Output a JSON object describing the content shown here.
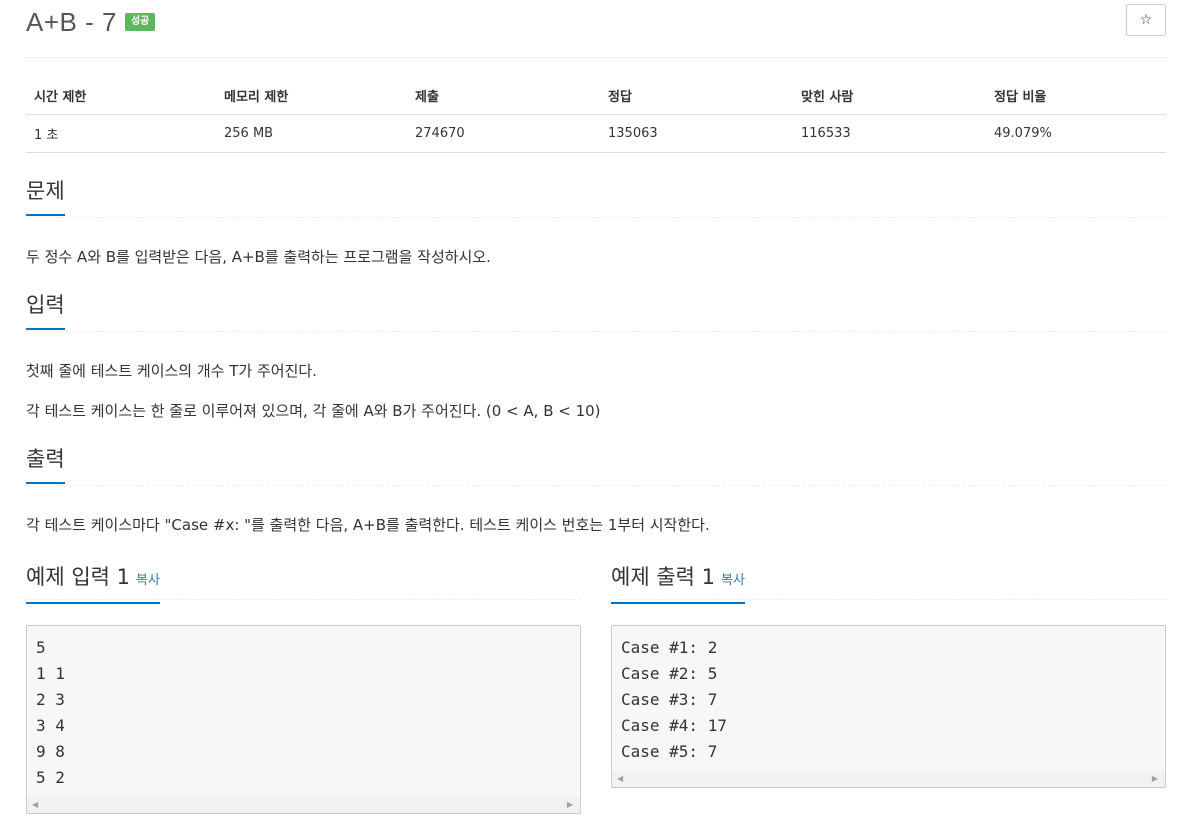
{
  "header": {
    "title": "A+B - 7",
    "badge": "성공",
    "star_icon": "☆"
  },
  "info_table": {
    "headers": [
      "시간 제한",
      "메모리 제한",
      "제출",
      "정답",
      "맞힌 사람",
      "정답 비율"
    ],
    "values": [
      "1 초",
      "256 MB",
      "274670",
      "135063",
      "116533",
      "49.079%"
    ]
  },
  "problem": {
    "heading": "문제",
    "text": "두 정수 A와 B를 입력받은 다음, A+B를 출력하는 프로그램을 작성하시오."
  },
  "input": {
    "heading": "입력",
    "lines": [
      "첫째 줄에 테스트 케이스의 개수 T가 주어진다.",
      "각 테스트 케이스는 한 줄로 이루어져 있으며, 각 줄에 A와 B가 주어진다. (0 < A, B < 10)"
    ]
  },
  "output": {
    "heading": "출력",
    "text": "각 테스트 케이스마다 \"Case #x: \"를 출력한 다음, A+B를 출력한다. 테스트 케이스 번호는 1부터 시작한다."
  },
  "sample_input": {
    "heading": "예제 입력 1",
    "copy_label": "복사",
    "content": "5\n1 1\n2 3\n3 4\n9 8\n5 2"
  },
  "sample_output": {
    "heading": "예제 출력 1",
    "copy_label": "복사",
    "content": "Case #1: 2\nCase #2: 5\nCase #3: 7\nCase #4: 17\nCase #5: 7"
  },
  "colors": {
    "accent": "#0076c0",
    "badge_success": "#5cb85c",
    "link": "#337ab7"
  }
}
